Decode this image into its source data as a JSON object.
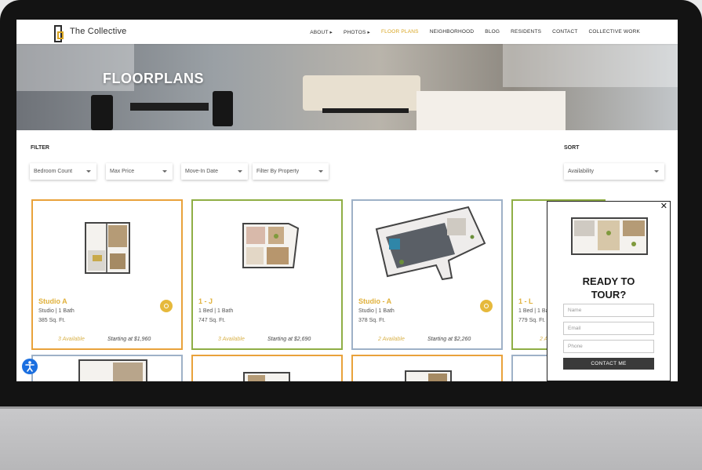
{
  "header": {
    "logo_text": "The Collective",
    "nav": [
      {
        "label": "ABOUT ▸",
        "active": false
      },
      {
        "label": "PHOTOS ▸",
        "active": false
      },
      {
        "label": "FLOOR PLANS",
        "active": true
      },
      {
        "label": "NEIGHBORHOOD",
        "active": false
      },
      {
        "label": "BLOG",
        "active": false
      },
      {
        "label": "RESIDENTS",
        "active": false
      },
      {
        "label": "CONTACT",
        "active": false
      },
      {
        "label": "COLLECTIVE WORK",
        "active": false
      }
    ]
  },
  "hero": {
    "title": "FLOORPLANS"
  },
  "filter": {
    "label": "FILTER",
    "bedroom": "Bedroom Count",
    "price": "Max Price",
    "movein": "Move-In Date",
    "property": "Filter By Property"
  },
  "sort": {
    "label": "SORT",
    "value": "Availability"
  },
  "cards": [
    {
      "name": "Studio A",
      "beds": "Studio | 1 Bath",
      "sqft": "385 Sq. Ft.",
      "available": "3 Available",
      "price": "Starting at $1,960",
      "border": "orange"
    },
    {
      "name": "1 - J",
      "beds": "1 Bed | 1 Bath",
      "sqft": "747 Sq. Ft.",
      "available": "3 Available",
      "price": "Starting at $2,690",
      "border": "green"
    },
    {
      "name": "Studio - A",
      "beds": "Studio | 1 Bath",
      "sqft": "378 Sq. Ft.",
      "available": "2 Available",
      "price": "Starting at $2,260",
      "border": "blue"
    },
    {
      "name": "1 - L",
      "beds": "1 Bed | 1 Bath",
      "sqft": "779 Sq. Ft.",
      "available": "2 A",
      "price": "",
      "border": "green"
    }
  ],
  "popup": {
    "close": "✕",
    "title_line1": "READY TO",
    "title_line2": "TOUR?",
    "name_placeholder": "Name",
    "email_placeholder": "Email",
    "phone_placeholder": "Phone",
    "button": "CONTACT ME"
  },
  "colors": {
    "accent": "#d9a521",
    "orange_border": "#e9a23b",
    "green_border": "#8fae45",
    "blue_border": "#9eb1c7",
    "accessibility": "#1b6fe0"
  }
}
